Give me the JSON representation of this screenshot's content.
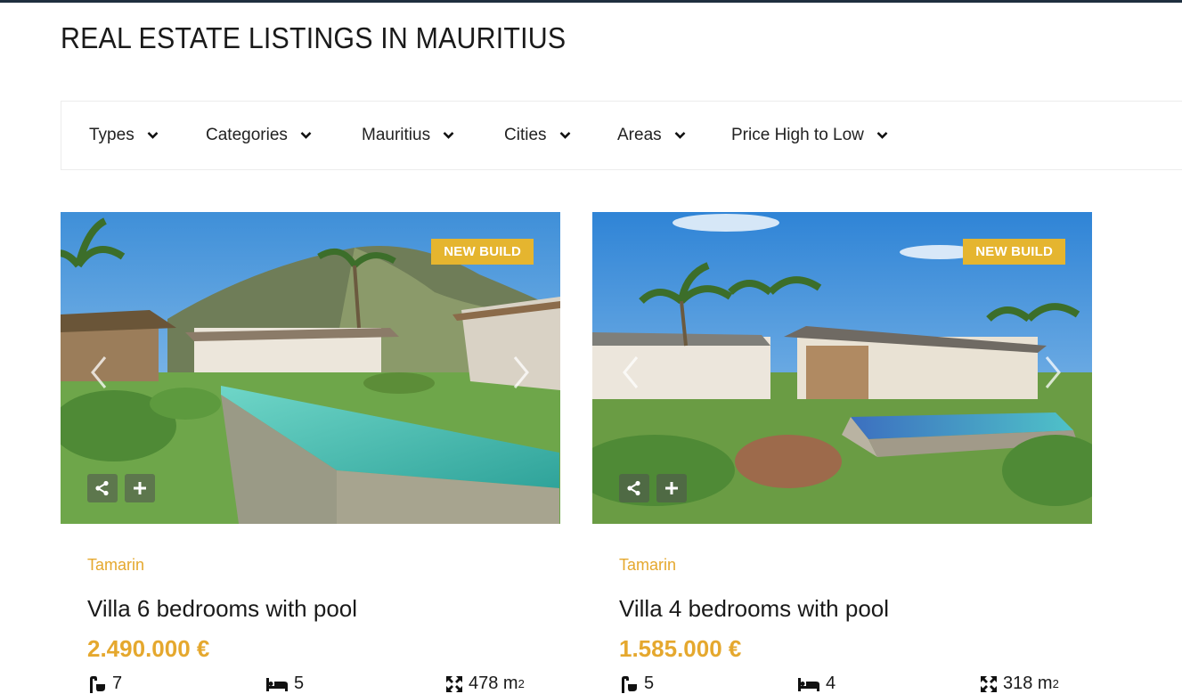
{
  "page": {
    "title": "REAL ESTATE LISTINGS IN MAURITIUS"
  },
  "filters": [
    {
      "label": "Types"
    },
    {
      "label": "Categories"
    },
    {
      "label": "Mauritius"
    },
    {
      "label": "Cities"
    },
    {
      "label": "Areas"
    },
    {
      "label": "Price High to Low"
    }
  ],
  "listings": [
    {
      "badge": "NEW BUILD",
      "city": "Tamarin",
      "title": "Villa 6 bedrooms with pool",
      "price": "2.490.000 €",
      "bathrooms": "7",
      "bedrooms": "5",
      "area": "478 m",
      "area_unit_sup": "2"
    },
    {
      "badge": "NEW BUILD",
      "city": "Tamarin",
      "title": "Villa 4 bedrooms with pool",
      "price": "1.585.000 €",
      "bathrooms": "5",
      "bedrooms": "4",
      "area": "318 m",
      "area_unit_sup": "2"
    }
  ],
  "colors": {
    "accent": "#e5a82e",
    "badge": "#e5b52f",
    "topbar": "#1f2f3f"
  }
}
